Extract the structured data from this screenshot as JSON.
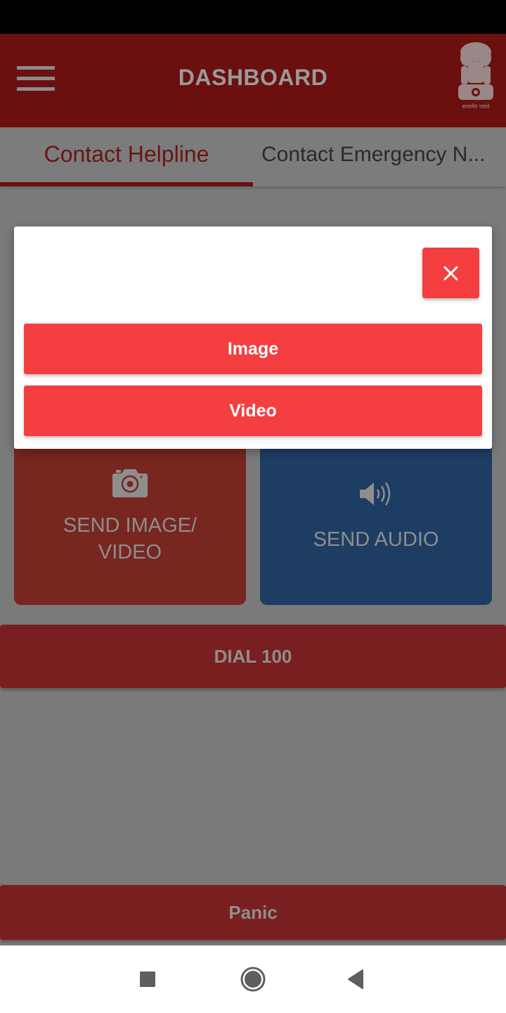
{
  "app_bar": {
    "title": "DASHBOARD",
    "menu_icon": "hamburger-menu-icon",
    "emblem_icon": "national-emblem-icon",
    "emblem_caption": "सत्यमेव जयते"
  },
  "tabs": [
    {
      "label": "Contact Helpline",
      "selected": true
    },
    {
      "label": "Contact Emergency N...",
      "selected": false
    }
  ],
  "tiles": [
    {
      "label": "SEND IMAGE/ VIDEO",
      "icon": "camera-icon",
      "color": "#782620"
    },
    {
      "label": "SEND AUDIO",
      "icon": "speaker-icon",
      "color": "#1d3d63"
    }
  ],
  "buttons": {
    "dial": "DIAL 100",
    "panic": "Panic"
  },
  "dialog": {
    "close_icon": "close-icon",
    "options": [
      "Image",
      "Video"
    ],
    "accent_color": "#f43e40"
  },
  "nav_bar": {
    "recent_icon": "recent-apps-icon",
    "home_icon": "home-icon",
    "back_icon": "back-icon"
  },
  "colors": {
    "primary": "#8b1a1a",
    "overlay": "rgba(0,0,0,0.5)"
  }
}
